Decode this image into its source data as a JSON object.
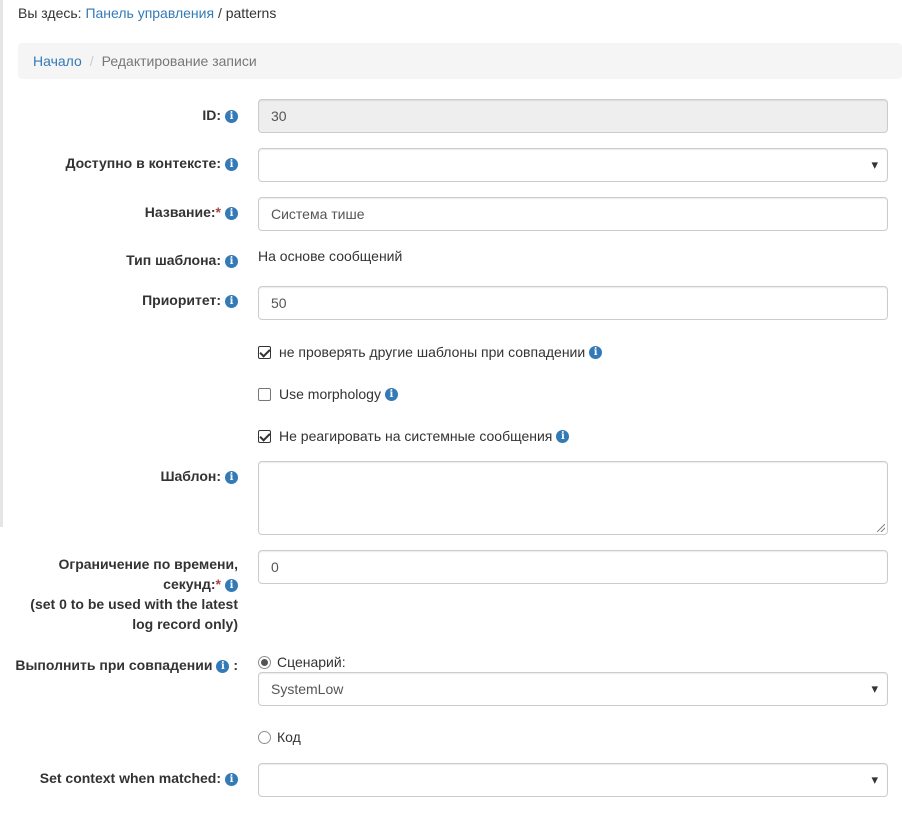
{
  "top_breadcrumb": {
    "prefix": "Вы здесь:",
    "link": "Панель управления",
    "separator": "/",
    "current": "patterns"
  },
  "crumb_bar": {
    "home": "Начало",
    "separator": "/",
    "active": "Редактирование записи"
  },
  "info_icon_glyph": "i",
  "required_mark": "*",
  "form": {
    "id": {
      "label": "ID:",
      "value": "30"
    },
    "context": {
      "label": "Доступно в контексте:",
      "value": ""
    },
    "name": {
      "label": "Название:",
      "value": "Система тише"
    },
    "type": {
      "label": "Тип шаблона:",
      "value": "На основе сообщений"
    },
    "priority": {
      "label": "Приоритет:",
      "value": "50"
    },
    "options": [
      {
        "label": "не проверять другие шаблоны при совпадении",
        "checked": true
      },
      {
        "label": "Use morphology",
        "checked": false
      },
      {
        "label": "Не реагировать на системные сообщения",
        "checked": true
      }
    ],
    "pattern": {
      "label": "Шаблон:",
      "value": ""
    },
    "time_limit": {
      "label_line1": "Ограничение по времени,",
      "label_line2": "секунд:",
      "note_line1": "(set 0 to be used with the latest",
      "note_line2": "log record only)",
      "value": "0"
    },
    "on_match": {
      "label": "Выполнить при совпадении",
      "colon": ":",
      "scenario_label": "Сценарий:",
      "scenario_checked": true,
      "scenario_value": "SystemLow",
      "code_label": "Код",
      "code_checked": false
    },
    "set_context": {
      "label": "Set context when matched:",
      "value": ""
    }
  },
  "icons": {
    "info": "info-circle-icon",
    "dropdown": "caret-down-icon",
    "resize": "resize-handle-icon"
  },
  "colors": {
    "link": "#337ab7",
    "required": "#a94442",
    "info_icon": "#337ab7",
    "breadcrumb_bg": "#f5f5f5",
    "readonly_bg": "#eeeeee"
  }
}
